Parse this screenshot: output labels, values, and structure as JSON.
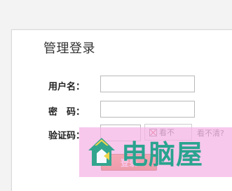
{
  "page": {
    "title": "管理登录"
  },
  "form": {
    "username_label": "用户名：",
    "password_label": "密　码：",
    "captcha_label": "验证码：",
    "username_value": "",
    "password_value": "",
    "captcha_value": "",
    "captcha_alt_text": "看不",
    "refresh_text": "看不清?",
    "login_label": "登录"
  },
  "watermark": {
    "text": "电脑屋"
  },
  "colors": {
    "page_background": "#f3f3f3",
    "panel_background": "#ffffff",
    "watermark_background": "#f5b2e5",
    "watermark_text": "#2aa38f",
    "login_button": "#e36f1f"
  },
  "icons": {
    "captcha_image": "broken-image-icon",
    "watermark_logo": "house-logo-icon"
  }
}
